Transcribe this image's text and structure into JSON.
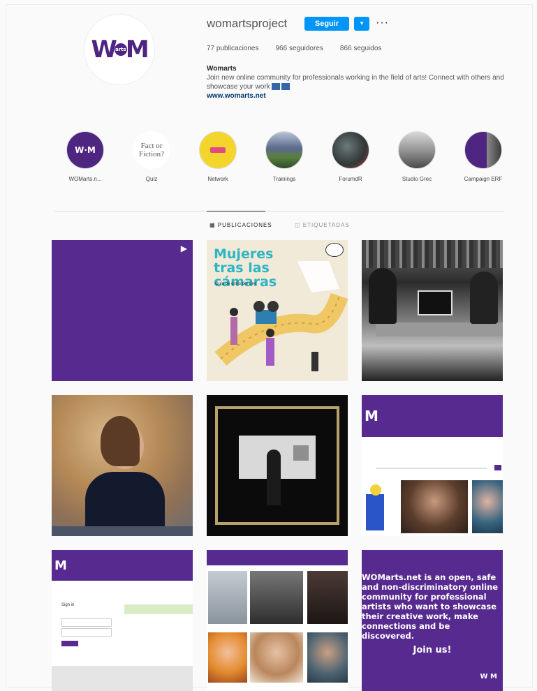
{
  "profile": {
    "username": "womartsproject",
    "follow_label": "Seguir",
    "dropdown_icon": "chevron-down-icon",
    "more_icon": "more-options-icon",
    "stats": {
      "posts": "77 publicaciones",
      "followers": "966 seguidores",
      "following": "866 seguidos"
    },
    "bio_name": "Womarts",
    "bio_text": "Join new online community for professionals working in the field of arts! Connect with others and showcase your work",
    "bio_link": "www.womarts.net",
    "logo_text_left": "W",
    "logo_text_mid": "arts",
    "logo_text_right": "M"
  },
  "highlights": [
    {
      "label": "WOMarts.n...",
      "kind": "logo"
    },
    {
      "label": "Quiz",
      "kind": "text",
      "inner": "Fact or Fiction?"
    },
    {
      "label": "Network",
      "kind": "yellow"
    },
    {
      "label": "Trainings",
      "kind": "photo"
    },
    {
      "label": "ForumdR",
      "kind": "photo"
    },
    {
      "label": "Studio Grec",
      "kind": "photo"
    },
    {
      "label": "Campaign ERF",
      "kind": "purple"
    }
  ],
  "tabs": {
    "posts": "PUBLICACIONES",
    "tagged": "ETIQUETADAS"
  },
  "posts": [
    {
      "kind": "purple-video",
      "alt": ""
    },
    {
      "kind": "illustration",
      "headline": "Mujeres tras las cámaras",
      "sub": "Guía de estilo del cine"
    },
    {
      "kind": "bw-photo"
    },
    {
      "kind": "portrait"
    },
    {
      "kind": "gallery"
    },
    {
      "kind": "website",
      "logo": "M"
    },
    {
      "kind": "signup",
      "logo": "M",
      "signup_label": "Sign in"
    },
    {
      "kind": "profiles"
    },
    {
      "kind": "text-card",
      "text": "WOMarts.net is an open, safe and non-discriminatory online community for professional artists who want to showcase their creative work, make connections and be discovered.",
      "cta": "Join us!",
      "logo": "W M"
    }
  ],
  "colors": {
    "accent": "#0095f6",
    "brand": "#4f2582"
  }
}
